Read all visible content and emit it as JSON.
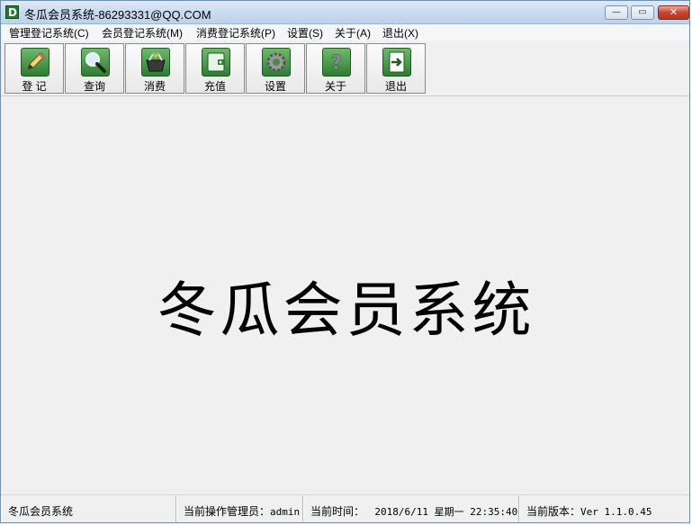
{
  "window": {
    "title": "冬瓜会员系统-86293331@QQ.COM",
    "app_icon_letter": "D",
    "controls": {
      "minimize": "—",
      "maximize": "▭",
      "close": "✕"
    }
  },
  "menu": {
    "items": [
      "管理登记系统(C)",
      "会员登记系统(M)",
      "消费登记系统(P)",
      "设置(S)",
      "关于(A)",
      "退出(X)"
    ]
  },
  "toolbar": {
    "buttons": [
      {
        "label": "登 记",
        "icon": "pencil-icon"
      },
      {
        "label": "查询",
        "icon": "magnifier-icon"
      },
      {
        "label": "消费",
        "icon": "basket-icon"
      },
      {
        "label": "充值",
        "icon": "wallet-icon"
      },
      {
        "label": "设置",
        "icon": "gear-icon"
      },
      {
        "label": "关于",
        "icon": "question-icon"
      },
      {
        "label": "退出",
        "icon": "exit-icon"
      }
    ]
  },
  "main": {
    "title": "冬瓜会员系统"
  },
  "statusbar": {
    "app_name": "冬瓜会员系统",
    "operator_label": "当前操作管理员：",
    "operator_value": "admin",
    "time_label": "当前时间：",
    "time_value": "2018/6/11 星期一  22:35:40",
    "version_label": "当前版本：",
    "version_value": "Ver 1.1.0.45"
  },
  "colors": {
    "icon_green": "#2f7d34",
    "title_bar": "#c9dbef",
    "close_red": "#c6452e"
  }
}
